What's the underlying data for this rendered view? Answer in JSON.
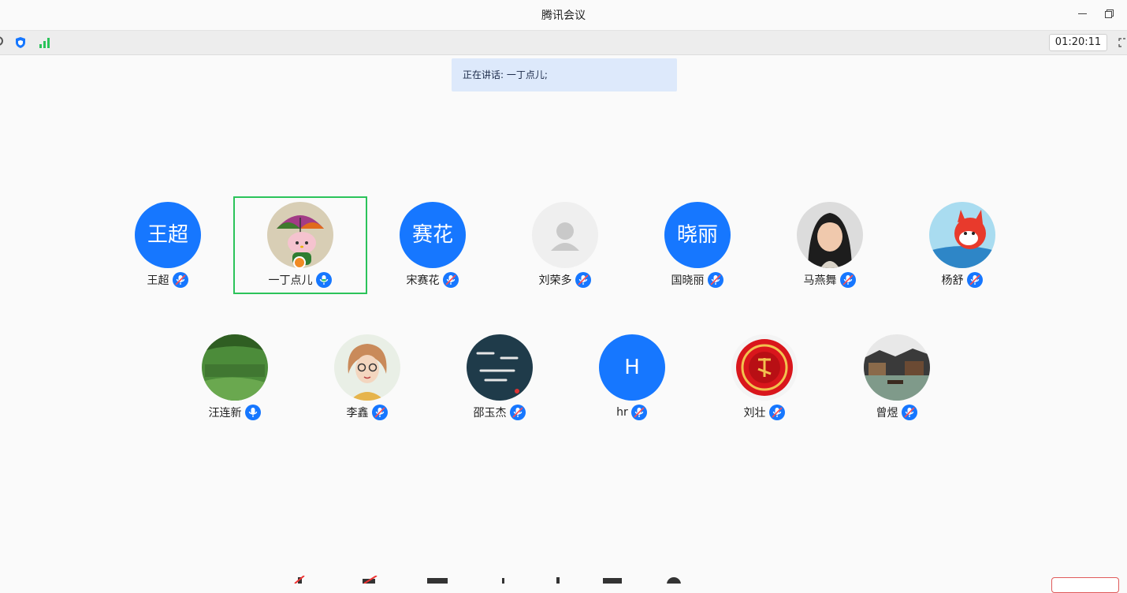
{
  "window": {
    "title": "腾讯会议"
  },
  "status": {
    "timer": "01:20:11"
  },
  "banner": {
    "speaking_text": "正在讲话: 一丁点儿;"
  },
  "participants": [
    {
      "name": "王超",
      "avatar_text": "王超",
      "avatar": "text",
      "mic": "muted"
    },
    {
      "name": "一丁点儿",
      "avatar": "kitty-image",
      "mic": "active",
      "is_speaking": true,
      "is_host": true
    },
    {
      "name": "宋赛花",
      "avatar_text": "赛花",
      "avatar": "text",
      "mic": "muted"
    },
    {
      "name": "刘荣多",
      "avatar": "default-person",
      "mic": "muted"
    },
    {
      "name": "国晓丽",
      "avatar_text": "晓丽",
      "avatar": "text",
      "mic": "muted"
    },
    {
      "name": "马燕舞",
      "avatar": "photo-woman",
      "mic": "muted"
    },
    {
      "name": "杨舒",
      "avatar": "cartoon-fox",
      "mic": "muted"
    },
    {
      "name": "汪连新",
      "avatar": "green-field-image",
      "mic": "active"
    },
    {
      "name": "李鑫",
      "avatar": "illustration-woman-glasses",
      "mic": "muted"
    },
    {
      "name": "邵玉杰",
      "avatar": "dark-text-image",
      "mic": "muted"
    },
    {
      "name": "hr",
      "avatar_text": "H",
      "avatar": "text",
      "mic": "muted"
    },
    {
      "name": "刘壮",
      "avatar": "red-seal-image",
      "mic": "muted"
    },
    {
      "name": "曾煜",
      "avatar": "town-photo",
      "mic": "muted"
    }
  ],
  "colors": {
    "accent": "#1677ff",
    "speaking_outline": "#2bc35a",
    "banner_bg": "#dde9fb",
    "leave": "#e05a5a"
  }
}
